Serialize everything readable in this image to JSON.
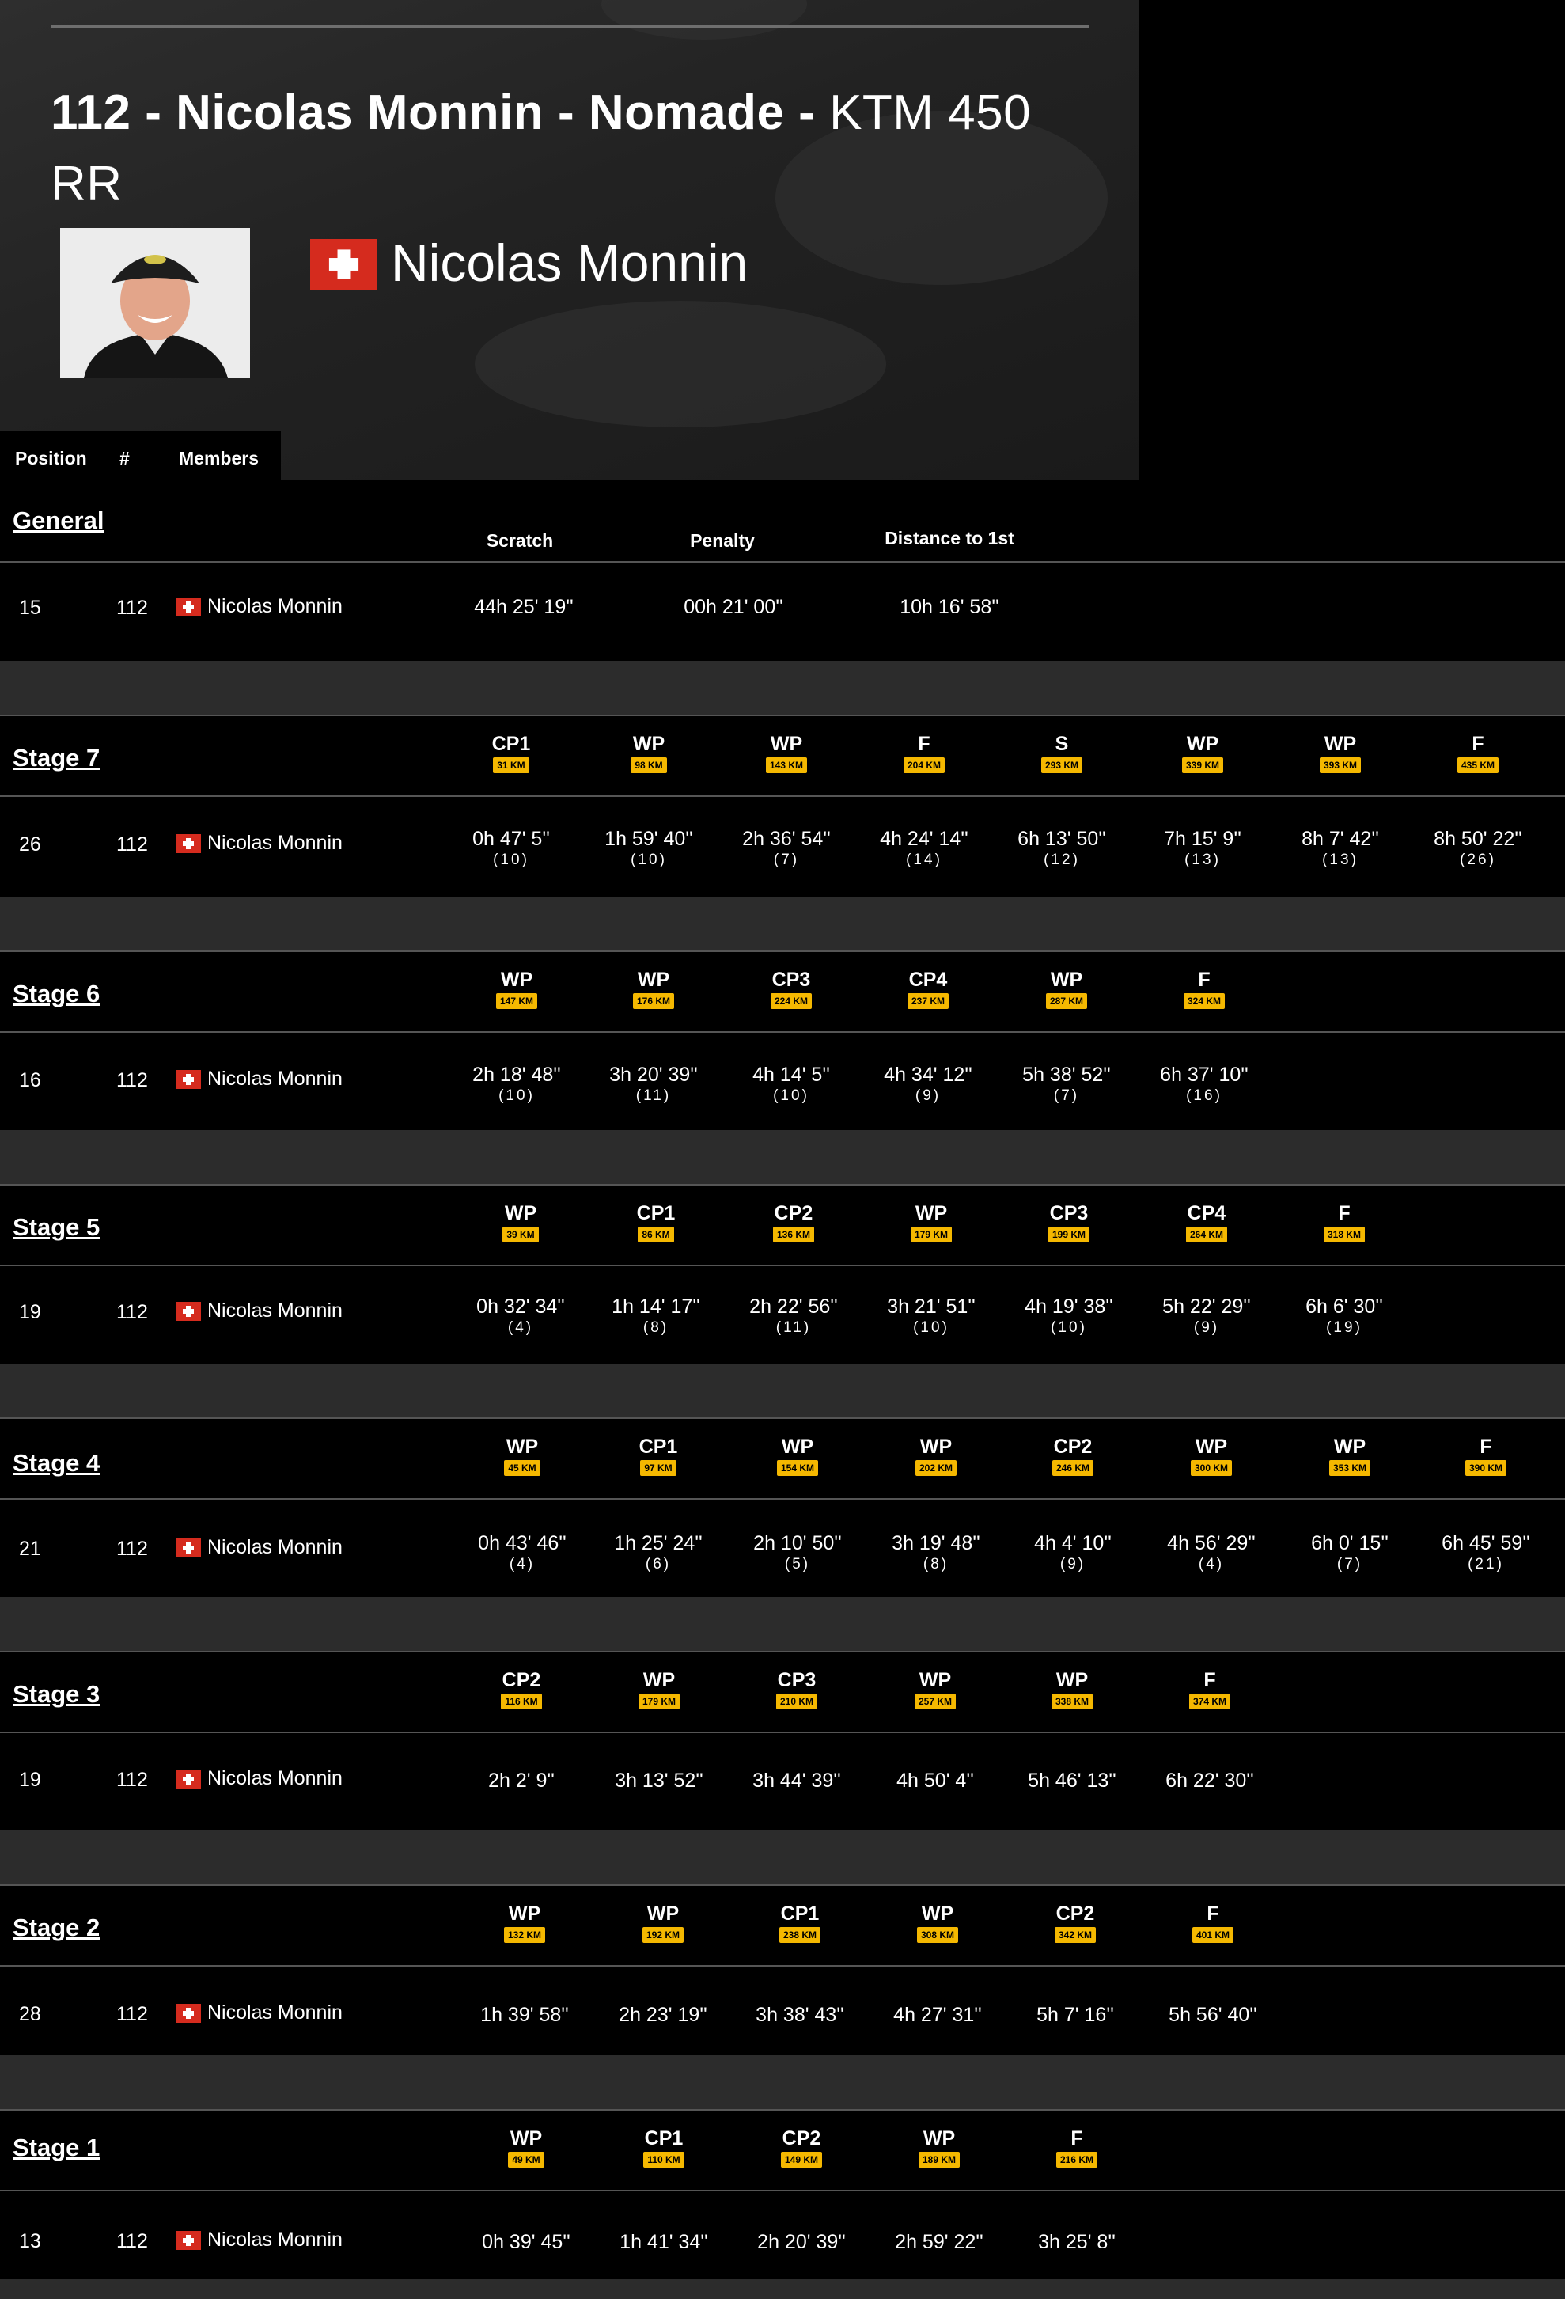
{
  "header": {
    "title_bold": "112 - Nicolas Monnin - Nomade -",
    "title_normal": "KTM 450 RR",
    "rider_name": "Nicolas Monnin"
  },
  "tabs": {
    "position": "Position",
    "number": "#",
    "members": "Members"
  },
  "general": {
    "title": "General",
    "col_scratch": "Scratch",
    "col_penalty": "Penalty",
    "col_distance": "Distance to 1st",
    "position": "15",
    "number": "112",
    "member": "Nicolas Monnin",
    "scratch": "44h 25' 19''",
    "penalty": "00h 21' 00''",
    "distance": "10h 16' 58''"
  },
  "stages": [
    {
      "title": "Stage 7",
      "position": "26",
      "number": "112",
      "member": "Nicolas Monnin",
      "checkpoints": [
        {
          "label": "CP1",
          "km": "31 KM",
          "time": "0h 47' 5''",
          "rank": "(10)"
        },
        {
          "label": "WP",
          "km": "98 KM",
          "time": "1h 59' 40''",
          "rank": "(10)"
        },
        {
          "label": "WP",
          "km": "143 KM",
          "time": "2h 36' 54''",
          "rank": "(7)"
        },
        {
          "label": "F",
          "km": "204 KM",
          "time": "4h 24' 14''",
          "rank": "(14)"
        },
        {
          "label": "S",
          "km": "293 KM",
          "time": "6h 13' 50''",
          "rank": "(12)"
        },
        {
          "label": "WP",
          "km": "339 KM",
          "time": "7h 15' 9''",
          "rank": "(13)"
        },
        {
          "label": "WP",
          "km": "393 KM",
          "time": "8h 7' 42''",
          "rank": "(13)"
        },
        {
          "label": "F",
          "km": "435 KM",
          "time": "8h 50' 22''",
          "rank": "(26)"
        }
      ]
    },
    {
      "title": "Stage 6",
      "position": "16",
      "number": "112",
      "member": "Nicolas Monnin",
      "checkpoints": [
        {
          "label": "WP",
          "km": "147 KM",
          "time": "2h 18' 48''",
          "rank": "(10)"
        },
        {
          "label": "WP",
          "km": "176 KM",
          "time": "3h 20' 39''",
          "rank": "(11)"
        },
        {
          "label": "CP3",
          "km": "224 KM",
          "time": "4h 14' 5''",
          "rank": "(10)"
        },
        {
          "label": "CP4",
          "km": "237 KM",
          "time": "4h 34' 12''",
          "rank": "(9)"
        },
        {
          "label": "WP",
          "km": "287 KM",
          "time": "5h 38' 52''",
          "rank": "(7)"
        },
        {
          "label": "F",
          "km": "324 KM",
          "time": "6h 37' 10''",
          "rank": "(16)"
        }
      ]
    },
    {
      "title": "Stage 5",
      "position": "19",
      "number": "112",
      "member": "Nicolas Monnin",
      "checkpoints": [
        {
          "label": "WP",
          "km": "39 KM",
          "time": "0h 32' 34''",
          "rank": "(4)"
        },
        {
          "label": "CP1",
          "km": "86 KM",
          "time": "1h 14' 17''",
          "rank": "(8)"
        },
        {
          "label": "CP2",
          "km": "136 KM",
          "time": "2h 22' 56''",
          "rank": "(11)"
        },
        {
          "label": "WP",
          "km": "179 KM",
          "time": "3h 21' 51''",
          "rank": "(10)"
        },
        {
          "label": "CP3",
          "km": "199 KM",
          "time": "4h 19' 38''",
          "rank": "(10)"
        },
        {
          "label": "CP4",
          "km": "264 KM",
          "time": "5h 22' 29''",
          "rank": "(9)"
        },
        {
          "label": "F",
          "km": "318 KM",
          "time": "6h 6' 30''",
          "rank": "(19)"
        }
      ]
    },
    {
      "title": "Stage 4",
      "position": "21",
      "number": "112",
      "member": "Nicolas Monnin",
      "checkpoints": [
        {
          "label": "WP",
          "km": "45 KM",
          "time": "0h 43' 46''",
          "rank": "(4)"
        },
        {
          "label": "CP1",
          "km": "97 KM",
          "time": "1h 25' 24''",
          "rank": "(6)"
        },
        {
          "label": "WP",
          "km": "154 KM",
          "time": "2h 10' 50''",
          "rank": "(5)"
        },
        {
          "label": "WP",
          "km": "202 KM",
          "time": "3h 19' 48''",
          "rank": "(8)"
        },
        {
          "label": "CP2",
          "km": "246 KM",
          "time": "4h 4' 10''",
          "rank": "(9)"
        },
        {
          "label": "WP",
          "km": "300 KM",
          "time": "4h 56' 29''",
          "rank": "(4)"
        },
        {
          "label": "WP",
          "km": "353 KM",
          "time": "6h 0' 15''",
          "rank": "(7)"
        },
        {
          "label": "F",
          "km": "390 KM",
          "time": "6h 45' 59''",
          "rank": "(21)"
        }
      ]
    },
    {
      "title": "Stage 3",
      "position": "19",
      "number": "112",
      "member": "Nicolas Monnin",
      "checkpoints": [
        {
          "label": "CP2",
          "km": "116 KM",
          "time": "2h 2' 9''",
          "rank": ""
        },
        {
          "label": "WP",
          "km": "179 KM",
          "time": "3h 13' 52''",
          "rank": ""
        },
        {
          "label": "CP3",
          "km": "210 KM",
          "time": "3h 44' 39''",
          "rank": ""
        },
        {
          "label": "WP",
          "km": "257 KM",
          "time": "4h 50' 4''",
          "rank": ""
        },
        {
          "label": "WP",
          "km": "338 KM",
          "time": "5h 46' 13''",
          "rank": ""
        },
        {
          "label": "F",
          "km": "374 KM",
          "time": "6h 22' 30''",
          "rank": ""
        }
      ]
    },
    {
      "title": "Stage 2",
      "position": "28",
      "number": "112",
      "member": "Nicolas Monnin",
      "checkpoints": [
        {
          "label": "WP",
          "km": "132 KM",
          "time": "1h 39' 58''",
          "rank": ""
        },
        {
          "label": "WP",
          "km": "192 KM",
          "time": "2h 23' 19''",
          "rank": ""
        },
        {
          "label": "CP1",
          "km": "238 KM",
          "time": "3h 38' 43''",
          "rank": ""
        },
        {
          "label": "WP",
          "km": "308 KM",
          "time": "4h 27' 31''",
          "rank": ""
        },
        {
          "label": "CP2",
          "km": "342 KM",
          "time": "5h 7' 16''",
          "rank": ""
        },
        {
          "label": "F",
          "km": "401 KM",
          "time": "5h 56' 40''",
          "rank": ""
        }
      ]
    },
    {
      "title": "Stage 1",
      "position": "13",
      "number": "112",
      "member": "Nicolas Monnin",
      "checkpoints": [
        {
          "label": "WP",
          "km": "49 KM",
          "time": "0h 39' 45''",
          "rank": ""
        },
        {
          "label": "CP1",
          "km": "110 KM",
          "time": "1h 41' 34''",
          "rank": ""
        },
        {
          "label": "CP2",
          "km": "149 KM",
          "time": "2h 20' 39''",
          "rank": ""
        },
        {
          "label": "WP",
          "km": "189 KM",
          "time": "2h 59' 22''",
          "rank": ""
        },
        {
          "label": "F",
          "km": "216 KM",
          "time": "3h 25' 8''",
          "rank": ""
        }
      ]
    }
  ]
}
